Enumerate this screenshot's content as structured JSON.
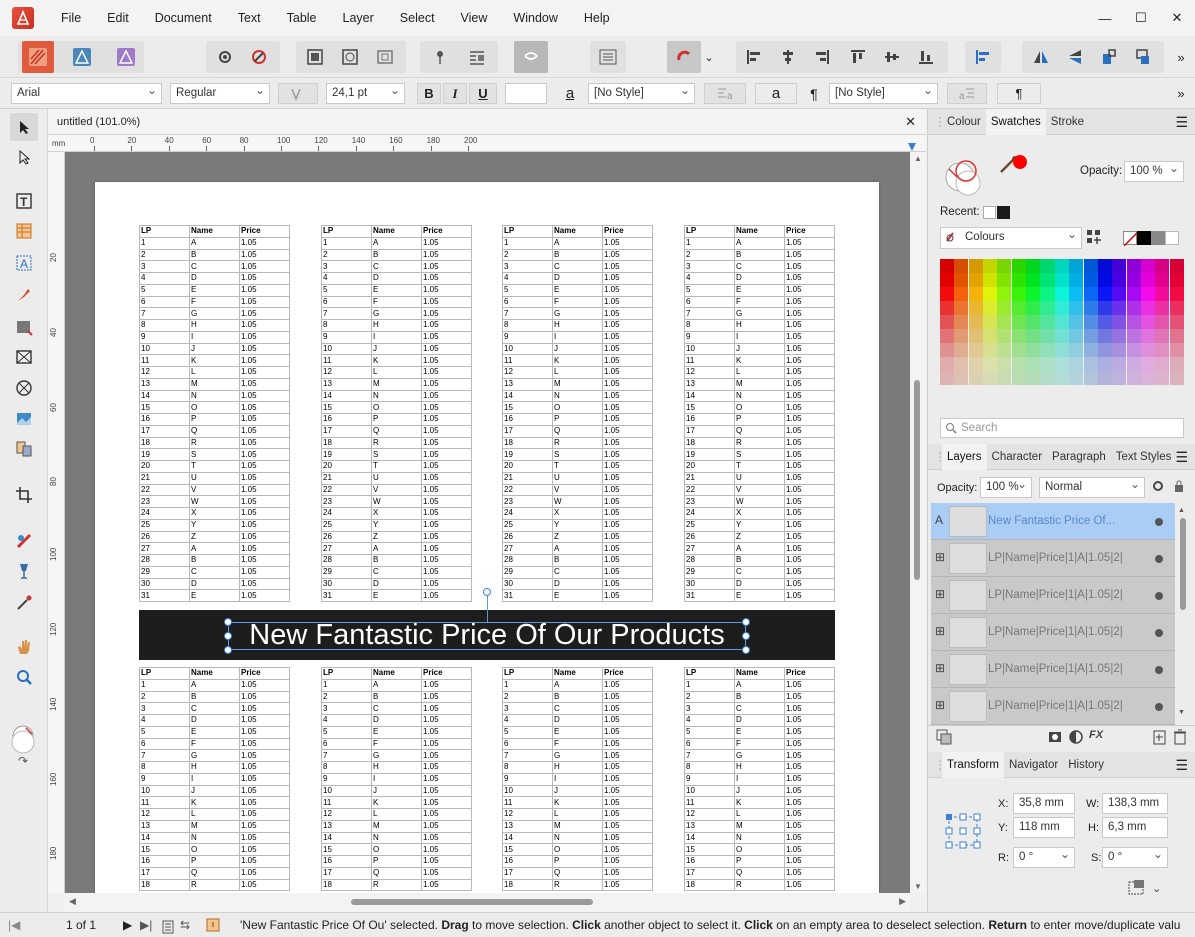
{
  "menu": [
    "File",
    "Edit",
    "Document",
    "Text",
    "Table",
    "Layer",
    "Select",
    "View",
    "Window",
    "Help"
  ],
  "window_controls": {
    "minimize": "—",
    "maximize": "☐",
    "close": "✕"
  },
  "toolbar": {
    "more_label": "»"
  },
  "context_bar": {
    "font_family": "Arial",
    "font_style": "Regular",
    "font_size": "24,1 pt",
    "char_style": "[No Style]",
    "para_style": "[No Style]",
    "bold_label": "B",
    "italic_label": "I",
    "underline_label": "U",
    "underline_a": "a",
    "small_a": "a",
    "pilcrow": "¶",
    "pilcrow2": "¶",
    "more_label": "»"
  },
  "doc_tab": {
    "title": "untitled (101.0%)",
    "close": "✕"
  },
  "ruler": {
    "unit": "mm",
    "h_ticks": [
      "0",
      "20",
      "40",
      "60",
      "80",
      "100",
      "120",
      "140",
      "160",
      "180",
      "200"
    ],
    "v_ticks": [
      "20",
      "40",
      "60",
      "80",
      "100",
      "120",
      "140",
      "160",
      "180"
    ]
  },
  "page": {
    "headers": [
      "LP",
      "Name",
      "Price"
    ],
    "letters": [
      "A",
      "B",
      "C",
      "D",
      "E",
      "F",
      "G",
      "H",
      "I",
      "J",
      "K",
      "L",
      "M",
      "N",
      "O",
      "P",
      "Q",
      "R",
      "S",
      "T",
      "U",
      "V",
      "W",
      "X",
      "Y",
      "Z",
      "A",
      "B",
      "C",
      "D",
      "E"
    ],
    "price": "1.05",
    "top_rows": 31,
    "bottom_rows": 18,
    "banner_text": "New Fantastic Price Of Our Products"
  },
  "colour_panel": {
    "tabs": [
      "Colour",
      "Swatches",
      "Stroke"
    ],
    "active_tab": "Swatches",
    "opacity_label": "Opacity:",
    "opacity_value": "100 %",
    "recent_label": "Recent:",
    "palette": "Colours",
    "search_placeholder": "Search",
    "fill_color": "#ff0000"
  },
  "layers_panel": {
    "tabs": [
      "Layers",
      "Character",
      "Paragraph",
      "Text Styles"
    ],
    "active_tab": "Layers",
    "opacity_label": "Opacity:",
    "opacity_value": "100 %",
    "blend_mode": "Normal",
    "layers": [
      {
        "type": "A",
        "name": "New Fantastic Price Of...",
        "selected": true
      },
      {
        "type": "⊞",
        "name": "LP|Name|Price|1|A|1.05|2|",
        "selected": false
      },
      {
        "type": "⊞",
        "name": "LP|Name|Price|1|A|1.05|2|",
        "selected": false
      },
      {
        "type": "⊞",
        "name": "LP|Name|Price|1|A|1.05|2|",
        "selected": false
      },
      {
        "type": "⊞",
        "name": "LP|Name|Price|1|A|1.05|2|",
        "selected": false
      },
      {
        "type": "⊞",
        "name": "LP|Name|Price|1|A|1.05|2|",
        "selected": false
      }
    ]
  },
  "transform_panel": {
    "tabs": [
      "Transform",
      "Navigator",
      "History"
    ],
    "active_tab": "Transform",
    "x_label": "X:",
    "x_value": "35,8 mm",
    "w_label": "W:",
    "w_value": "138,3 mm",
    "y_label": "Y:",
    "y_value": "118 mm",
    "h_label": "H:",
    "h_value": "6,3 mm",
    "r_label": "R:",
    "r_value": "0 °",
    "s_label": "S:",
    "s_value": "0 °"
  },
  "status": {
    "page_info": "1 of 1",
    "msg_1": "'New Fantastic Price Of Ou' selected. ",
    "k1": "Drag",
    "msg_2": " to move selection. ",
    "k2": "Click",
    "msg_3": " another object to select it. ",
    "k3": "Click",
    "msg_4": " on an empty area to deselect selection. ",
    "k4": "Return",
    "msg_5": " to enter move/duplicate valu"
  },
  "colors": {
    "accent": "#3c80d6",
    "banner_bg": "#1d1d1d",
    "brand": "#e04a35"
  }
}
